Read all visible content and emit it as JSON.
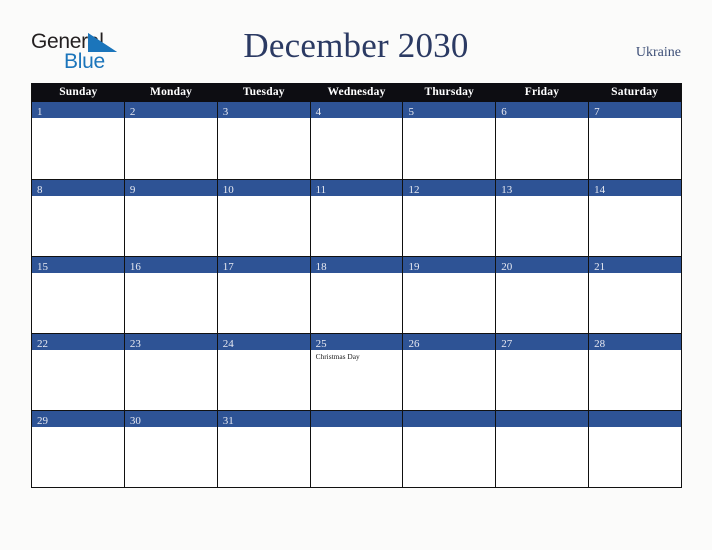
{
  "brand": {
    "name_part1": "General",
    "name_part2": "Blue",
    "triangle_color": "#1b75bb",
    "part1_color": "#231f20",
    "part2_color": "#1b75bb"
  },
  "header": {
    "title": "December 2030",
    "country": "Ukraine",
    "title_color": "#2b3a63",
    "country_color": "#3d4f77"
  },
  "calendar": {
    "accent_color": "#2e5395",
    "header_bg": "#0d0d12",
    "border_color": "#111111",
    "day_names": [
      "Sunday",
      "Monday",
      "Tuesday",
      "Wednesday",
      "Thursday",
      "Friday",
      "Saturday"
    ],
    "weeks": [
      [
        {
          "day": "1",
          "events": []
        },
        {
          "day": "2",
          "events": []
        },
        {
          "day": "3",
          "events": []
        },
        {
          "day": "4",
          "events": []
        },
        {
          "day": "5",
          "events": []
        },
        {
          "day": "6",
          "events": []
        },
        {
          "day": "7",
          "events": []
        }
      ],
      [
        {
          "day": "8",
          "events": []
        },
        {
          "day": "9",
          "events": []
        },
        {
          "day": "10",
          "events": []
        },
        {
          "day": "11",
          "events": []
        },
        {
          "day": "12",
          "events": []
        },
        {
          "day": "13",
          "events": []
        },
        {
          "day": "14",
          "events": []
        }
      ],
      [
        {
          "day": "15",
          "events": []
        },
        {
          "day": "16",
          "events": []
        },
        {
          "day": "17",
          "events": []
        },
        {
          "day": "18",
          "events": []
        },
        {
          "day": "19",
          "events": []
        },
        {
          "day": "20",
          "events": []
        },
        {
          "day": "21",
          "events": []
        }
      ],
      [
        {
          "day": "22",
          "events": []
        },
        {
          "day": "23",
          "events": []
        },
        {
          "day": "24",
          "events": []
        },
        {
          "day": "25",
          "events": [
            "Christmas Day"
          ]
        },
        {
          "day": "26",
          "events": []
        },
        {
          "day": "27",
          "events": []
        },
        {
          "day": "28",
          "events": []
        }
      ],
      [
        {
          "day": "29",
          "events": []
        },
        {
          "day": "30",
          "events": []
        },
        {
          "day": "31",
          "events": []
        },
        {
          "day": "",
          "events": []
        },
        {
          "day": "",
          "events": []
        },
        {
          "day": "",
          "events": []
        },
        {
          "day": "",
          "events": []
        }
      ]
    ]
  }
}
